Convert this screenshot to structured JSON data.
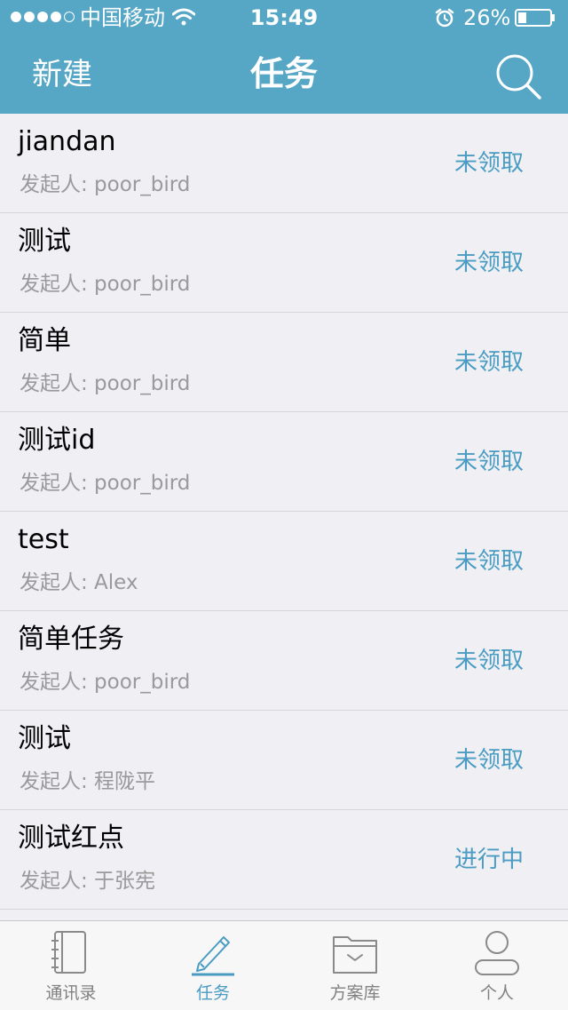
{
  "status_bar": {
    "carrier": "中国移动",
    "time": "15:49",
    "battery": "26%"
  },
  "nav": {
    "left_label": "新建",
    "title": "任务"
  },
  "tasks": [
    {
      "title": "jiandan",
      "initiator": "发起人: poor_bird",
      "status": "未领取"
    },
    {
      "title": "测试",
      "initiator": "发起人: poor_bird",
      "status": "未领取"
    },
    {
      "title": "简单",
      "initiator": "发起人: poor_bird",
      "status": "未领取"
    },
    {
      "title": "测试id",
      "initiator": "发起人: poor_bird",
      "status": "未领取"
    },
    {
      "title": "test",
      "initiator": "发起人: Alex",
      "status": "未领取"
    },
    {
      "title": "简单任务",
      "initiator": "发起人: poor_bird",
      "status": "未领取"
    },
    {
      "title": "测试",
      "initiator": "发起人: 程陇平",
      "status": "未领取"
    },
    {
      "title": "测试红点",
      "initiator": "发起人: 于张宪",
      "status": "进行中"
    }
  ],
  "tabs": [
    {
      "label": "通讯录",
      "icon": "contacts-icon"
    },
    {
      "label": "任务",
      "icon": "pencil-icon"
    },
    {
      "label": "方案库",
      "icon": "folder-icon"
    },
    {
      "label": "个人",
      "icon": "person-icon"
    }
  ],
  "colors": {
    "header_bg": "#56a6c6",
    "accent": "#4a9cc2",
    "list_bg": "#efeff4",
    "subtitle": "#9a9a9a"
  }
}
